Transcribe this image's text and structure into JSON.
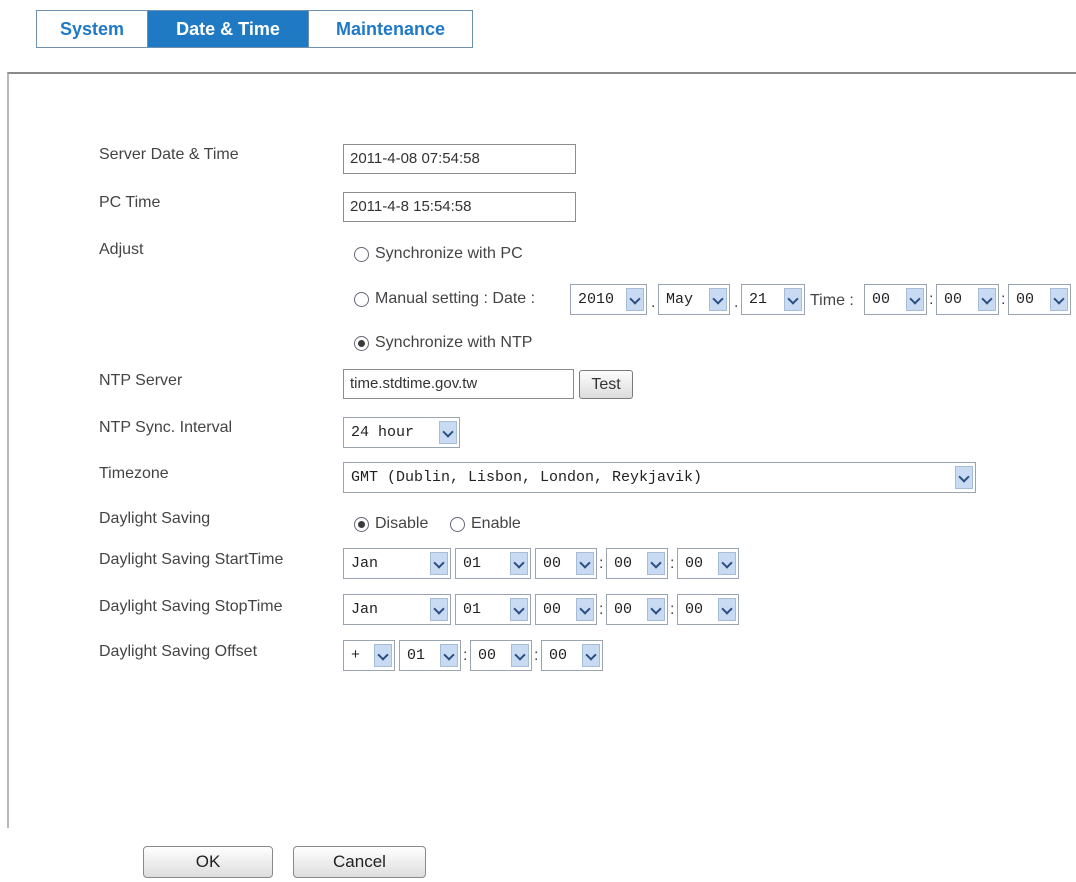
{
  "tabs": [
    {
      "label": "System"
    },
    {
      "label": "Date & Time"
    },
    {
      "label": "Maintenance"
    }
  ],
  "form": {
    "server_datetime": {
      "label": "Server Date & Time",
      "value": "2011-4-08 07:54:58"
    },
    "pc_time": {
      "label": "PC Time",
      "value": "2011-4-8 15:54:58"
    },
    "adjust": {
      "label": "Adjust",
      "sync_pc": "Synchronize with PC",
      "manual_label": "Manual setting : Date :",
      "manual_year": "2010",
      "manual_month": "May",
      "manual_day": "21",
      "time_label": "Time :",
      "manual_hour": "00",
      "manual_min": "00",
      "manual_sec": "00",
      "sync_ntp": "Synchronize with NTP",
      "selected": "sync_ntp"
    },
    "ntp_server": {
      "label": "NTP Server",
      "value": "time.stdtime.gov.tw",
      "test_label": "Test"
    },
    "ntp_interval": {
      "label": "NTP Sync. Interval",
      "value": "24 hour"
    },
    "timezone": {
      "label": "Timezone",
      "value": "GMT (Dublin, Lisbon, London, Reykjavik)"
    },
    "daylight_saving": {
      "label": "Daylight Saving",
      "disable": "Disable",
      "enable": "Enable",
      "selected": "disable"
    },
    "ds_start": {
      "label": "Daylight Saving StartTime",
      "month": "Jan",
      "day": "01",
      "hour": "00",
      "min": "00",
      "sec": "00"
    },
    "ds_stop": {
      "label": "Daylight Saving StopTime",
      "month": "Jan",
      "day": "01",
      "hour": "00",
      "min": "00",
      "sec": "00"
    },
    "ds_offset": {
      "label": "Daylight Saving Offset",
      "sign": "+",
      "hour": "01",
      "min": "00",
      "sec": "00"
    },
    "separators": {
      "dot": ".",
      "colon": ":"
    }
  },
  "buttons": {
    "ok": "OK",
    "cancel": "Cancel"
  }
}
